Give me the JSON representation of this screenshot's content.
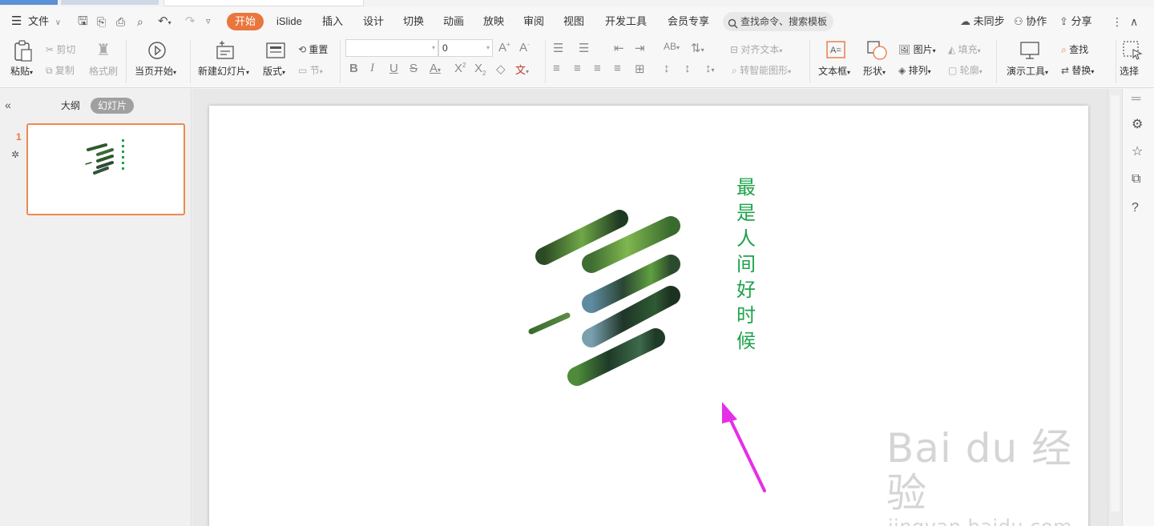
{
  "menubar": {
    "file_label": "文件",
    "tabs": [
      "开始",
      "iSlide",
      "插入",
      "设计",
      "切换",
      "动画",
      "放映",
      "审阅",
      "视图",
      "开发工具",
      "会员专享"
    ],
    "search_placeholder": "查找命令、搜索模板",
    "sync_label": "未同步",
    "collab_label": "协作",
    "share_label": "分享"
  },
  "ribbon": {
    "paste": "粘贴",
    "cut": "剪切",
    "copy": "复制",
    "format_painter": "格式刷",
    "from_current": "当页开始",
    "new_slide": "新建幻灯片",
    "layout": "版式",
    "reset": "重置",
    "section": "节",
    "font_size": "0",
    "align_text": "对齐文本",
    "smart_graphic": "转智能图形",
    "textbox": "文本框",
    "shape": "形状",
    "picture": "图片",
    "fill": "填充",
    "arrange": "排列",
    "outline": "轮廓",
    "present_tools": "演示工具",
    "find": "查找",
    "replace": "替换",
    "select": "选择"
  },
  "left_panel": {
    "outline_tab": "大纲",
    "slides_tab": "幻灯片",
    "slide_number": "1"
  },
  "slide": {
    "vertical_text": [
      "最",
      "是",
      "人",
      "间",
      "好",
      "时",
      "候"
    ],
    "text_color": "#1ea34a",
    "arrow_color": "#e62ee6"
  },
  "watermark": {
    "main": "Bai du 经验",
    "sub": "jingyan.baidu.com"
  },
  "colors": {
    "accent": "#e9763d",
    "forest_dark": "#1f3a22",
    "forest_light": "#6fa847"
  }
}
